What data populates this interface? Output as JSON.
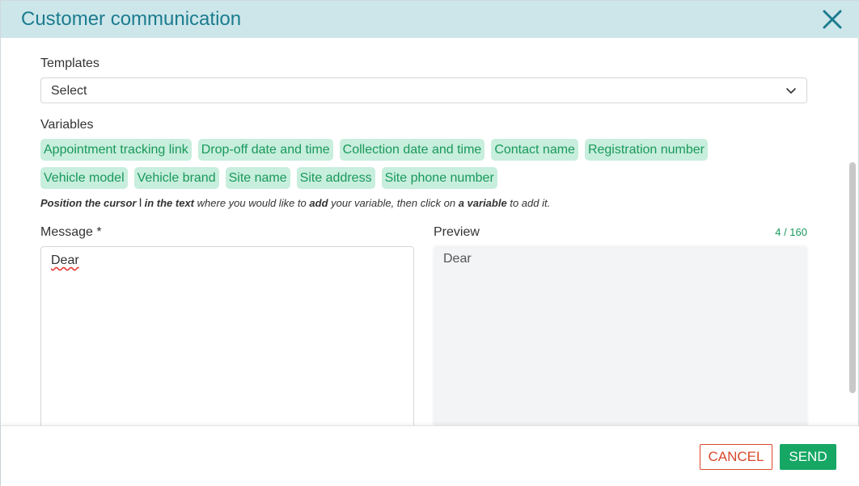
{
  "dialog": {
    "title": "Customer communication",
    "close_icon": "close-icon"
  },
  "templates": {
    "label": "Templates",
    "selected_value": "Select",
    "chevron_icon": "chevron-down-icon"
  },
  "variables": {
    "label": "Variables",
    "row1": [
      "Appointment tracking link",
      "Drop-off date and time",
      "Collection date and time",
      "Contact name",
      "Registration number"
    ],
    "row2": [
      "Vehicle model",
      "Vehicle brand",
      "Site name",
      "Site address",
      "Site phone number"
    ]
  },
  "hint": {
    "part1": "Position the cursor",
    "cursor_glyph": "I",
    "part2": "in the text",
    "part3": "where you would like to",
    "part4": "add",
    "part5": "your variable, then click on",
    "part6": "a variable",
    "part7": "to add it."
  },
  "message": {
    "label": "Message *",
    "value": "Dear"
  },
  "preview": {
    "label": "Preview",
    "value": "Dear",
    "char_count": "4 / 160"
  },
  "footer": {
    "cancel_label": "CANCEL",
    "send_label": "SEND"
  },
  "colors": {
    "header_bg": "#cde6ea",
    "title": "#1b7c8f",
    "chip_bg": "#c8eedd",
    "chip_text": "#18995b",
    "cancel": "#d9482b",
    "send": "#16a764"
  }
}
